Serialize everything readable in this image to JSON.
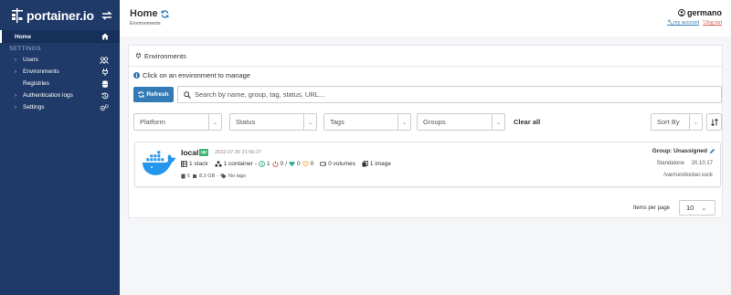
{
  "sidebar": {
    "logo_text": "portainer.io",
    "section_label": "SETTINGS",
    "items": [
      {
        "label": "Home",
        "icon": "home-icon",
        "active": true
      },
      {
        "label": "Users",
        "icon": "users-icon"
      },
      {
        "label": "Environments",
        "icon": "plug-icon"
      },
      {
        "label": "Registries",
        "icon": "database-icon"
      },
      {
        "label": "Authentication logs",
        "icon": "history-icon"
      },
      {
        "label": "Settings",
        "icon": "cogs-icon"
      }
    ]
  },
  "header": {
    "title": "Home",
    "breadcrumb": "Environments",
    "username": "germano",
    "my_account": "my account",
    "log_out": "log out"
  },
  "panel": {
    "title": "Environments",
    "hint": "Click on an environment to manage",
    "refresh_label": "Refresh",
    "search_placeholder": "Search by name, group, tag, status, URL...",
    "filters": {
      "platform": "Platform",
      "status": "Status",
      "tags": "Tags",
      "groups": "Groups",
      "clear_all": "Clear all",
      "sort_by": "Sort By"
    }
  },
  "environment": {
    "name": "local",
    "status": "up",
    "timestamp": "2022-07-30 21:56:27",
    "stacks": "1 stack",
    "containers": "1 container",
    "healthy": "1",
    "unhealthy": "0",
    "running": "0",
    "stopped": "0",
    "volumes": "0 volumes",
    "images": "1 image",
    "cpu": "6",
    "memory": "8.3 GB",
    "tags": "No tags",
    "group": "Group: Unassigned",
    "type": "Standalone",
    "version": "20.10.17",
    "url": "/var/run/docker.sock"
  },
  "pagination": {
    "label": "Items per page",
    "value": "10"
  },
  "colors": {
    "sidebar_bg": "#1f3a68",
    "accent": "#337ab7",
    "badge_up": "#3cb371",
    "docker_blue": "#2496ed"
  }
}
